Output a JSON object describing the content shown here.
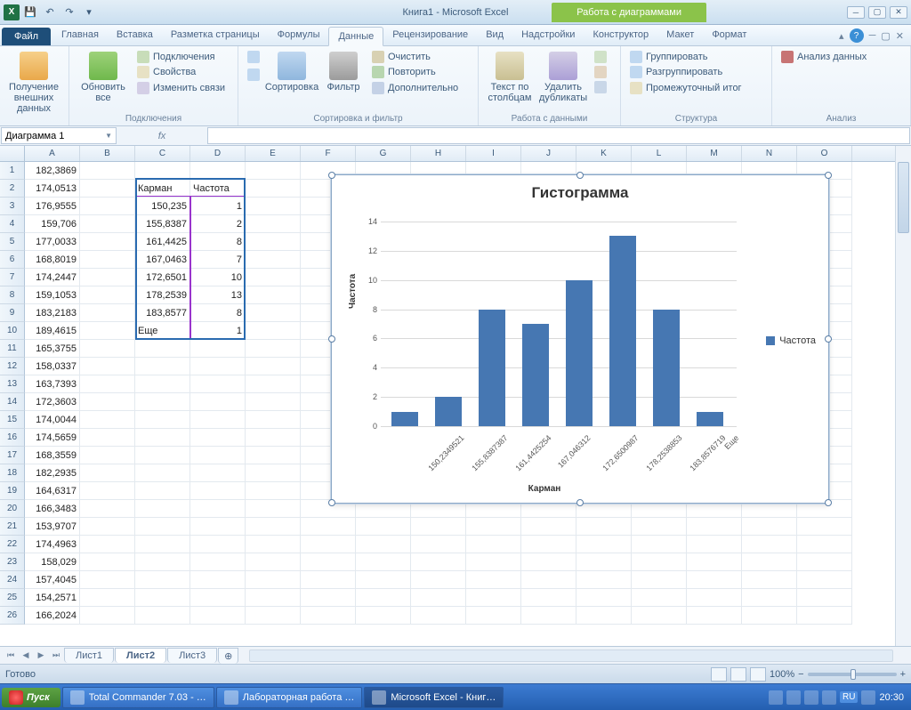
{
  "window": {
    "title_doc": "Книга1",
    "title_app": " - Microsoft Excel",
    "chart_tools": "Работа с диаграммами"
  },
  "file_tab": "Файл",
  "tabs": [
    "Главная",
    "Вставка",
    "Разметка страницы",
    "Формулы",
    "Данные",
    "Рецензирование",
    "Вид",
    "Надстройки",
    "Конструктор",
    "Макет",
    "Формат"
  ],
  "active_tab_index": 4,
  "ribbon": {
    "g1": {
      "label": "",
      "btn": "Получение\nвнешних данных"
    },
    "g2": {
      "label": "Подключения",
      "refresh": "Обновить\nвсе",
      "a": "Подключения",
      "b": "Свойства",
      "c": "Изменить связи"
    },
    "g3": {
      "label": "Сортировка и фильтр",
      "sort": "Сортировка",
      "filter": "Фильтр",
      "a": "Очистить",
      "b": "Повторить",
      "c": "Дополнительно"
    },
    "g4": {
      "label": "Работа с данными",
      "a": "Текст по\nстолбцам",
      "b": "Удалить\nдубликаты"
    },
    "g5": {
      "label": "Структура",
      "a": "Группировать",
      "b": "Разгруппировать",
      "c": "Промежуточный итог"
    },
    "g6": {
      "label": "Анализ",
      "a": "Анализ данных"
    }
  },
  "namebox": "Диаграмма 1",
  "fx_symbol": "fx",
  "columns": [
    "A",
    "B",
    "C",
    "D",
    "E",
    "F",
    "G",
    "H",
    "I",
    "J",
    "K",
    "L",
    "M",
    "N",
    "O"
  ],
  "colA": [
    "182,3869",
    "174,0513",
    "176,9555",
    "159,706",
    "177,0033",
    "168,8019",
    "174,2447",
    "159,1053",
    "183,2183",
    "189,4615",
    "165,3755",
    "158,0337",
    "163,7393",
    "172,3603",
    "174,0044",
    "174,5659",
    "168,3559",
    "182,2935",
    "164,6317",
    "166,3483",
    "153,9707",
    "174,4963",
    "158,029",
    "157,4045",
    "154,2571",
    "166,2024"
  ],
  "table_headers": {
    "c": "Карман",
    "d": "Частота"
  },
  "tableC": [
    "150,235",
    "155,8387",
    "161,4425",
    "167,0463",
    "172,6501",
    "178,2539",
    "183,8577",
    "Еще"
  ],
  "tableD": [
    "1",
    "2",
    "8",
    "7",
    "10",
    "13",
    "8",
    "1"
  ],
  "chart_data": {
    "type": "bar",
    "title": "Гистограмма",
    "xlabel": "Карман",
    "ylabel": "Частота",
    "ylim": [
      0,
      14
    ],
    "yticks": [
      0,
      2,
      4,
      6,
      8,
      10,
      12,
      14
    ],
    "categories": [
      "150,2349521",
      "155,8387387",
      "161,4425254",
      "167,046312",
      "172,6500987",
      "178,2538853",
      "183,8576719",
      "Еще"
    ],
    "values": [
      1,
      2,
      8,
      7,
      10,
      13,
      8,
      1
    ],
    "legend": "Частота"
  },
  "sheet_tabs": [
    "Лист1",
    "Лист2",
    "Лист3"
  ],
  "active_sheet": 1,
  "status": {
    "ready": "Готово",
    "zoom": "100%"
  },
  "taskbar": {
    "start": "Пуск",
    "items": [
      "Total Commander 7.03 - …",
      "Лабораторная работа …",
      "Microsoft Excel - Книг…"
    ],
    "lang": "RU",
    "time": "20:30"
  }
}
